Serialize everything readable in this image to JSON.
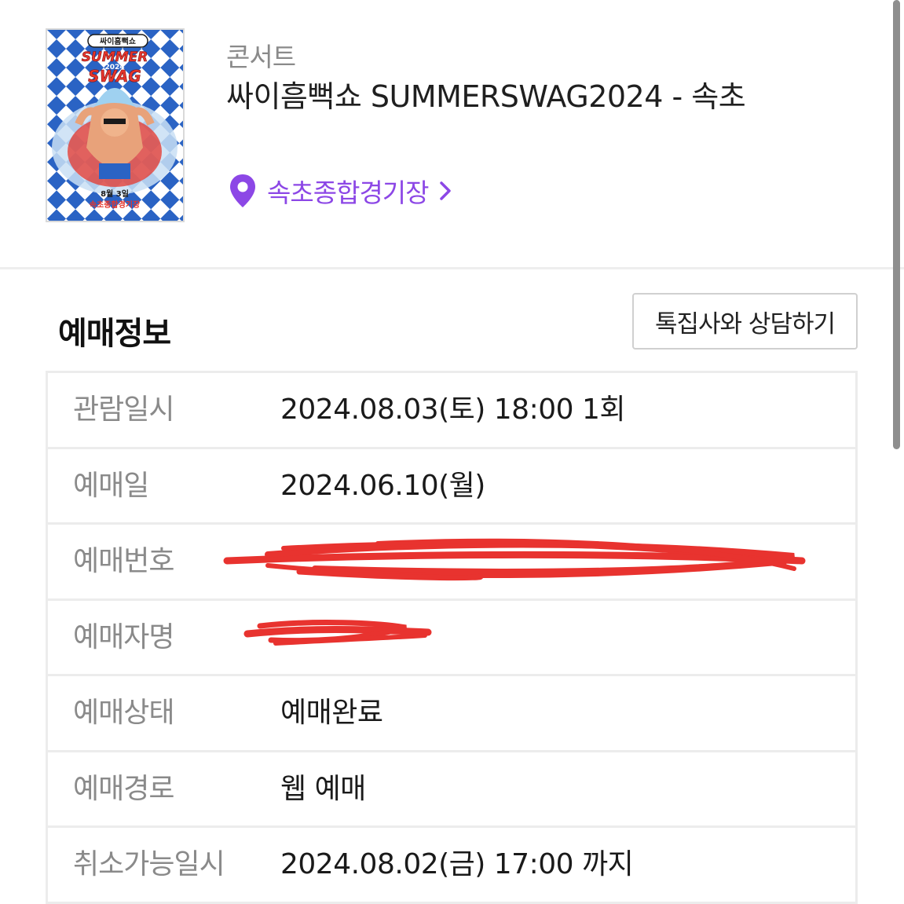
{
  "event": {
    "category": "콘서트",
    "title": "싸이흠뻑쇼 SUMMERSWAG2024 - 속초",
    "venue": "속초종합경기장",
    "poster": {
      "top_label": "싸이흠뻑쇼",
      "headline_1": "SUMMER",
      "headline_year": "2024",
      "headline_2": "SWAG",
      "date_label": "8월 3일",
      "venue_label": "속초종합경기장"
    }
  },
  "booking": {
    "section_title": "예매정보",
    "consult_button": "톡집사와 상담하기",
    "rows": [
      {
        "label": "관람일시",
        "value": "2024.08.03(토) 18:00 1회"
      },
      {
        "label": "예매일",
        "value": "2024.06.10(월)"
      },
      {
        "label": "예매번호",
        "value": ""
      },
      {
        "label": "예매자명",
        "value": ""
      },
      {
        "label": "예매상태",
        "value": "예매완료"
      },
      {
        "label": "예매경로",
        "value": "웹 예매"
      },
      {
        "label": "취소가능일시",
        "value": "2024.08.02(금) 17:00 까지"
      }
    ]
  },
  "colors": {
    "accent": "#8c47e6",
    "redaction": "#e8332f",
    "label_gray": "#8a8a8a",
    "poster_blue": "#2a63c4"
  }
}
